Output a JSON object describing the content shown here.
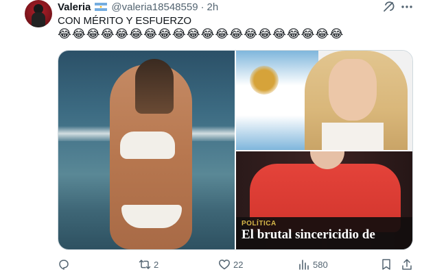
{
  "tweet": {
    "author_name": "Valeria",
    "flag_icon": "argentina-flag-icon",
    "handle": "@valeria18548559",
    "separator": "·",
    "time": "2h",
    "text": "CON MÉRITO Y ESFUERZO",
    "emojis": "😂😂😂😂😂😂😂😂😂😂😂😂😂😂😂😂😂😂😂😂",
    "media": {
      "bottom_right": {
        "category": "POLÍTICA",
        "headline": "El brutal sincericidio de"
      }
    },
    "actions": {
      "reply_icon": "reply-icon",
      "retweet_count": "2",
      "like_count": "22",
      "views_count": "580",
      "bookmark_icon": "bookmark-icon",
      "share_icon": "share-icon"
    }
  },
  "colors": {
    "text_primary": "#0f1419",
    "text_secondary": "#536471",
    "border": "#cfd9de"
  }
}
